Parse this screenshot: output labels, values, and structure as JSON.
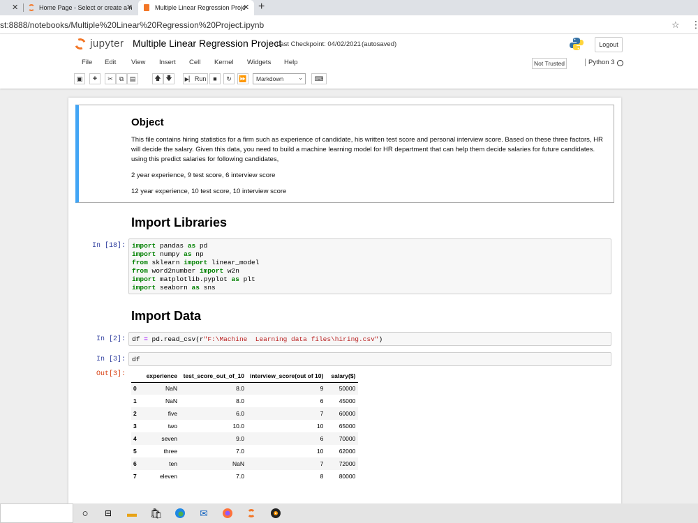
{
  "browser": {
    "tabs": [
      {
        "label": "Home Page - Select or create a n"
      },
      {
        "label": "Multiple Linear Regression Proje"
      }
    ],
    "new_tab": "+",
    "url": "st:8888/notebooks/Multiple%20Linear%20Regression%20Project.ipynb"
  },
  "jupyter": {
    "logo_text": "jupyter",
    "notebook_title": "Multiple Linear Regression Project",
    "checkpoint": "Last Checkpoint: 04/02/2021",
    "autosaved": "(autosaved)",
    "logout": "Logout",
    "menu": [
      "File",
      "Edit",
      "View",
      "Insert",
      "Cell",
      "Kernel",
      "Widgets",
      "Help"
    ],
    "trust": "Not Trusted",
    "kernel": "Python 3",
    "toolbar": {
      "run_label": "Run",
      "cell_type": "Markdown"
    }
  },
  "cells": {
    "object": {
      "heading": "Object",
      "para1": "This file contains hiring statistics for a firm such as experience of candidate, his written test score and personal interview score. Based on these three factors, HR will decide the salary. Given this data, you need to build a machine learning model for HR department that can help them decide salaries for future candidates. using this predict salaries for following candidates,",
      "para2": "2 year experience, 9 test score, 6 interview score",
      "para3": "12 year experience, 10 test score, 10 interview score"
    },
    "import_libraries": {
      "heading": "Import Libraries"
    },
    "code18": {
      "prompt": "In [18]:",
      "lines": [
        {
          "kw1": "import",
          "rest1": " pandas ",
          "kw2": "as",
          "rest2": " pd"
        },
        {
          "kw1": "import",
          "rest1": " numpy ",
          "kw2": "as",
          "rest2": " np"
        },
        {
          "kw1": "from",
          "rest1": " sklearn ",
          "kw2": "import",
          "rest2": " linear_model"
        },
        {
          "kw1": "from",
          "rest1": " word2number ",
          "kw2": "import",
          "rest2": " w2n"
        },
        {
          "kw1": "import",
          "rest1": " matplotlib.pyplot ",
          "kw2": "as",
          "rest2": " plt"
        },
        {
          "kw1": "import",
          "rest1": " seaborn ",
          "kw2": "as",
          "rest2": " sns"
        }
      ]
    },
    "import_data": {
      "heading": "Import Data"
    },
    "code2": {
      "prompt": "In [2]:",
      "pre": "df ",
      "eq": "=",
      "mid": " pd.read_csv(r",
      "str": "\"F:\\Machine  Learning data files\\hiring.csv\"",
      "post": ")"
    },
    "code3": {
      "prompt": "In [3]:",
      "code": "df",
      "out_prompt": "Out[3]:"
    }
  },
  "dataframe": {
    "columns": [
      "experience",
      "test_score_out_of_10",
      "interview_score(out of 10)",
      "salary($)"
    ],
    "rows": [
      {
        "idx": "0",
        "experience": "NaN",
        "test": "8.0",
        "interview": "9",
        "salary": "50000"
      },
      {
        "idx": "1",
        "experience": "NaN",
        "test": "8.0",
        "interview": "6",
        "salary": "45000"
      },
      {
        "idx": "2",
        "experience": "five",
        "test": "6.0",
        "interview": "7",
        "salary": "60000"
      },
      {
        "idx": "3",
        "experience": "two",
        "test": "10.0",
        "interview": "10",
        "salary": "65000"
      },
      {
        "idx": "4",
        "experience": "seven",
        "test": "9.0",
        "interview": "6",
        "salary": "70000"
      },
      {
        "idx": "5",
        "experience": "three",
        "test": "7.0",
        "interview": "10",
        "salary": "62000"
      },
      {
        "idx": "6",
        "experience": "ten",
        "test": "NaN",
        "interview": "7",
        "salary": "72000"
      },
      {
        "idx": "7",
        "experience": "eleven",
        "test": "7.0",
        "interview": "8",
        "salary": "80000"
      }
    ]
  },
  "colors": {
    "jupyter_orange": "#f37626",
    "selected_cell_border": "#42a5f5",
    "input_prompt": "#303f9f",
    "output_prompt": "#d84315",
    "keyword": "#008000",
    "string": "#ba2121"
  }
}
